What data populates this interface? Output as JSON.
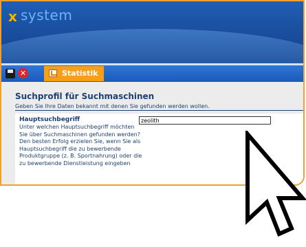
{
  "app": {
    "logo_symbol": "x",
    "logo_text": "system"
  },
  "toolbar": {
    "save_icon": "save-icon",
    "close_icon": "close-icon",
    "close_glyph": "✕",
    "tab_label": "Statistik"
  },
  "form": {
    "title": "Suchprofil für Suchmaschinen",
    "subtitle": "Geben Sie Ihre Daten bekannt mit denen Sie gefunden werden wollen.",
    "field": {
      "label": "Hauptsuchbegriff",
      "help": "Unter welchen Hauptsuchbegriff möchten Sie über Suchmaschinen gefunden werden? Den besten Erfolg erzielen Sie, wenn Sie als Hauptsuchbegriff die zu bewerbende Produktgruppe (z. B. Sportnahrung) oder die zu bewerbende Dienstleistung eingeben",
      "value": "zeolith"
    }
  },
  "colors": {
    "accent": "#f5a018",
    "header": "#1b4fa0",
    "text": "#1d3f73"
  }
}
